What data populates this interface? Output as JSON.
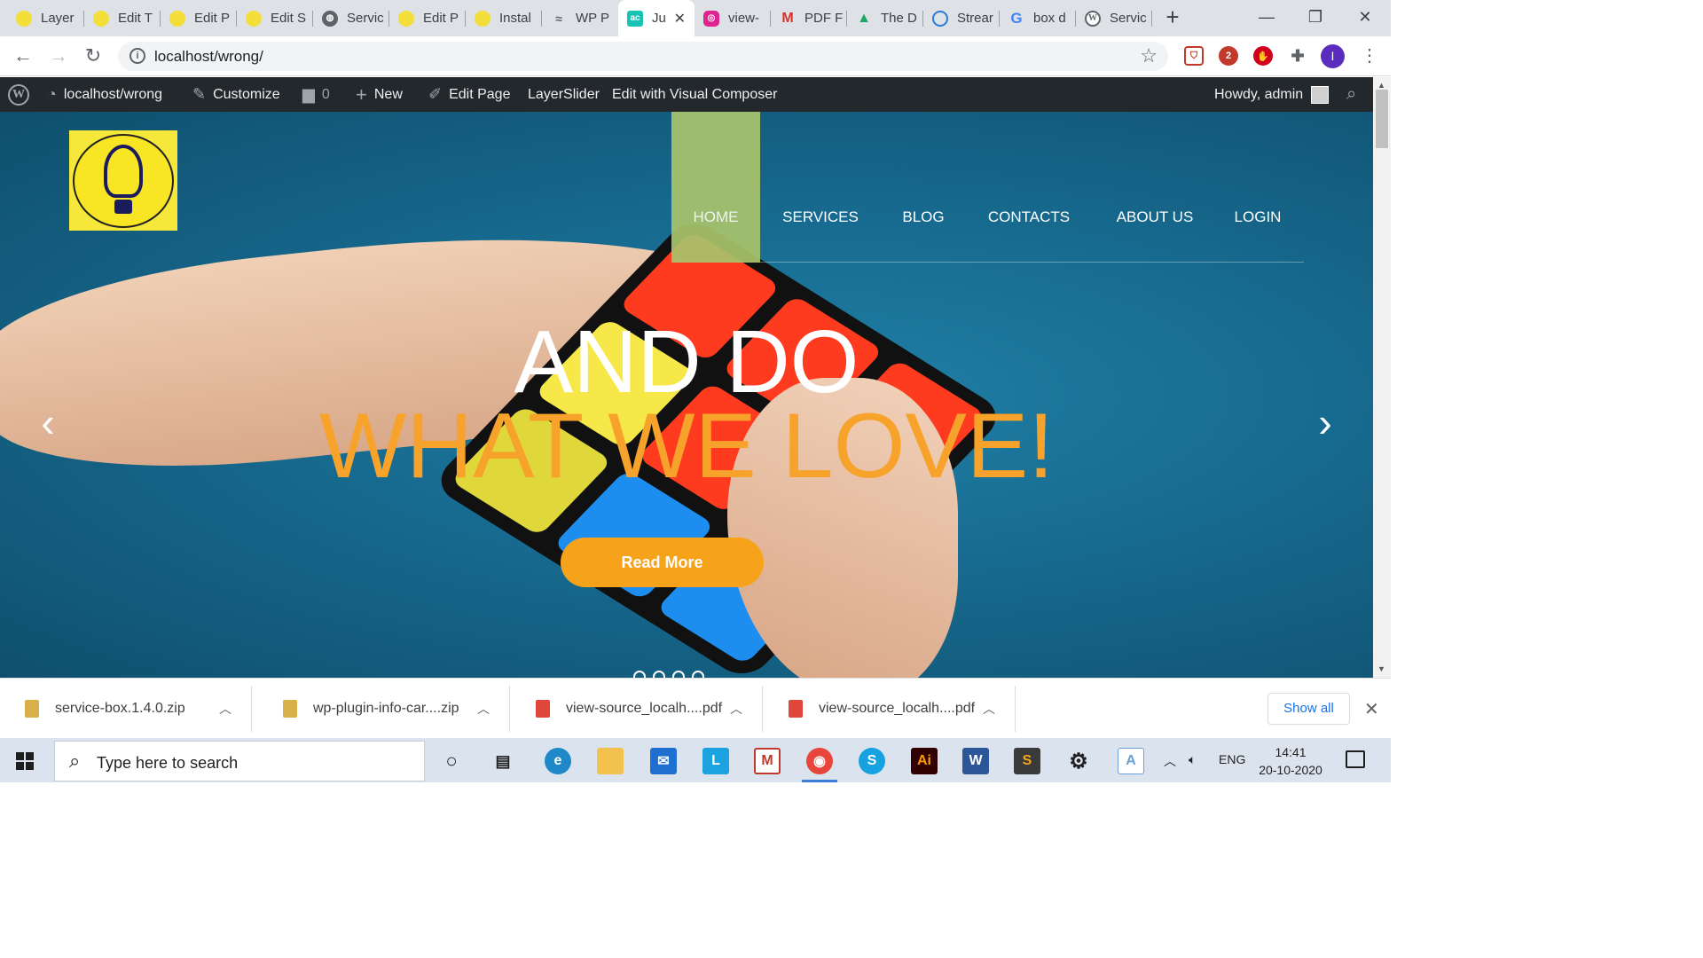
{
  "browser": {
    "tabs": [
      {
        "label": "Layer",
        "favicon": "idea-logo-icon"
      },
      {
        "label": "Edit T",
        "favicon": "idea-logo-icon"
      },
      {
        "label": "Edit P",
        "favicon": "idea-logo-icon"
      },
      {
        "label": "Edit S",
        "favicon": "idea-logo-icon"
      },
      {
        "label": "Servic",
        "favicon": "globe-icon"
      },
      {
        "label": "Edit P",
        "favicon": "idea-logo-icon"
      },
      {
        "label": "Instal",
        "favicon": "idea-logo-icon"
      },
      {
        "label": "WP P",
        "favicon": "wp-plugin-icon"
      },
      {
        "label": "Ju",
        "favicon": "ac-icon"
      },
      {
        "label": "view-",
        "favicon": "pdf-tool-icon"
      },
      {
        "label": "PDF F",
        "favicon": "gmail-icon"
      },
      {
        "label": "The D",
        "favicon": "drive-icon"
      },
      {
        "label": "Strear",
        "favicon": "stream-icon"
      },
      {
        "label": "box d",
        "favicon": "google-icon"
      },
      {
        "label": "Servic",
        "favicon": "wordpress-icon"
      }
    ],
    "active_tab_index": 8,
    "address": "localhost/wrong/"
  },
  "admin_bar": {
    "site_name": "localhost/wrong",
    "customize": "Customize",
    "comments_count": "0",
    "new": "New",
    "edit_page": "Edit Page",
    "layerslider": "LayerSlider",
    "visual_composer": "Edit with Visual Composer",
    "howdy": "Howdy, admin"
  },
  "site": {
    "nav": [
      {
        "label": "HOME",
        "active": true
      },
      {
        "label": "SERVICES",
        "active": false
      },
      {
        "label": "BLOG",
        "active": false
      },
      {
        "label": "CONTACTS",
        "active": false
      },
      {
        "label": "ABOUT US",
        "active": false
      },
      {
        "label": "LOGIN",
        "active": false
      }
    ],
    "hero": {
      "line1": "AND DO",
      "line2": "WHAT WE LOVE!",
      "button": "Read More"
    },
    "colors": {
      "accent_orange": "#f7a21b",
      "nav_active": "#a9c46c",
      "hero_blue": "#176a8f"
    }
  },
  "downloads": {
    "items": [
      {
        "name": "service-box.1.4.0.zip",
        "type": "zip"
      },
      {
        "name": "wp-plugin-info-car....zip",
        "type": "zip"
      },
      {
        "name": "view-source_localh....pdf",
        "type": "pdf"
      },
      {
        "name": "view-source_localh....pdf",
        "type": "pdf"
      }
    ],
    "show_all": "Show all"
  },
  "taskbar": {
    "search_placeholder": "Type here to search",
    "language": "ENG",
    "time": "14:41",
    "date": "20-10-2020"
  }
}
